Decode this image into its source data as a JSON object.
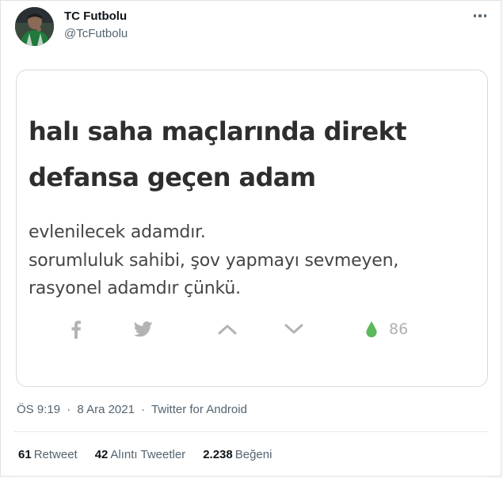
{
  "author": {
    "name": "TC Futbolu",
    "handle": "@TcFutbolu"
  },
  "media_card": {
    "headline": [
      "halı saha maçlarında direkt",
      "defansa geçen adam"
    ],
    "body": [
      "evlenilecek adamdır.",
      "sorumluluk sahibi, şov yapmayı sevmeyen,",
      "rasyonel adamdır çünkü."
    ],
    "actions": {
      "icons": [
        "facebook-icon",
        "twitter-bird-icon",
        "upvote-chevron-icon",
        "downvote-chevron-icon",
        "drop-icon"
      ],
      "count": "86",
      "drop_color": "#5cb85c"
    }
  },
  "meta": {
    "time": "ÖS 9:19",
    "date": "8 Ara 2021",
    "separator": "·",
    "source": "Twitter for Android"
  },
  "stats": {
    "retweets": {
      "count": "61",
      "label": "Retweet"
    },
    "quotes": {
      "count": "42",
      "label": "Alıntı Tweetler"
    },
    "likes": {
      "count": "2.238",
      "label": "Beğeni"
    }
  }
}
